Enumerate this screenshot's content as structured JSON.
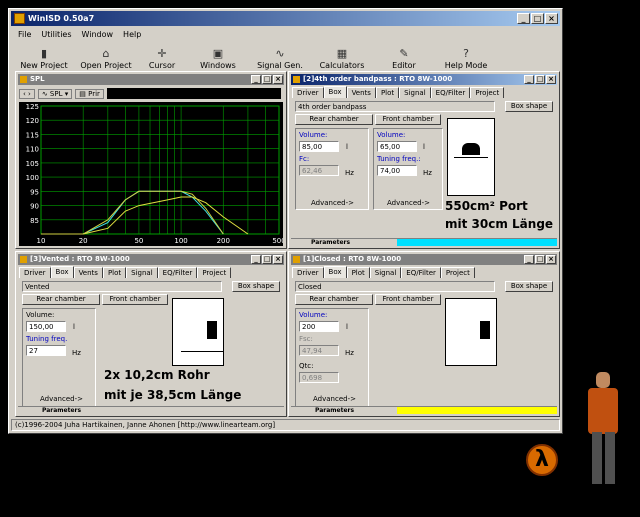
{
  "app": {
    "title": "WinISD 0.50a7",
    "menu": [
      "File",
      "Utilities",
      "Window",
      "Help"
    ],
    "toolbar": {
      "new_project": "New Project",
      "open_project": "Open Project",
      "cursor": "Cursor",
      "windows": "Windows",
      "signal_gen": "Signal Gen.",
      "calculators": "Calculators",
      "editor": "Editor",
      "help_mode": "Help Mode"
    },
    "status": "(c)1996-2004 Juha Hartikainen, Janne Ahonen [http://www.linearteam.org]"
  },
  "spl": {
    "title": "SPL",
    "mode_label": "SPL",
    "print_label": "Prir",
    "colors": {
      "series_cyan": "#40e0e0",
      "series_yellow": "#e0e040",
      "grid": "#00a000"
    }
  },
  "chart_data": {
    "type": "line",
    "title": "",
    "xlabel": "",
    "ylabel": "",
    "x_scale": "log",
    "xlim": [
      10,
      500
    ],
    "ylim": [
      80,
      125
    ],
    "x_ticks": [
      "10",
      "20",
      "50",
      "100",
      "200",
      "500"
    ],
    "y_ticks": [
      "125",
      "120",
      "115",
      "110",
      "105",
      "100",
      "95",
      "90",
      "85"
    ],
    "series": [
      {
        "color": "#40e0e0",
        "x": [
          10,
          20,
          30,
          40,
          50,
          60,
          80,
          100,
          120,
          150,
          200
        ],
        "y": [
          57,
          72,
          84,
          92,
          95,
          95,
          95,
          95,
          93,
          88,
          78
        ]
      },
      {
        "color": "#e0e040",
        "x": [
          10,
          20,
          30,
          40,
          50,
          80,
          100,
          120,
          150,
          200,
          300
        ],
        "y": [
          55,
          70,
          82,
          88,
          90,
          92,
          93,
          93,
          91,
          86,
          80
        ]
      },
      {
        "color": "#d0d040",
        "x": [
          10,
          20,
          30,
          40,
          50,
          80,
          100,
          120,
          150,
          200
        ],
        "y": [
          60,
          74,
          85,
          92,
          95,
          95,
          95,
          94,
          89,
          80
        ]
      }
    ]
  },
  "bandpass": {
    "title": "[2]4th order bandpass : RTO 8W-1000",
    "tabs": [
      "Driver",
      "Box",
      "Vents",
      "Plot",
      "Signal",
      "EQ/Filter",
      "Project"
    ],
    "box_name": "4th order bandpass",
    "box_shape": "Box shape",
    "rear_chamber": "Rear chamber",
    "front_chamber": "Front chamber",
    "rear_volume_label": "Volume:",
    "rear_volume": "85,00",
    "rear_volume_unit": "l",
    "fsc_label": "Fc:",
    "fsc_value": "62,46",
    "fsc_unit": "Hz",
    "front_volume_label": "Volume:",
    "front_volume": "65,00",
    "front_volume_unit": "l",
    "tuning_label": "Tuning freq.:",
    "tuning_value": "74,00",
    "tuning_unit": "Hz",
    "advanced": "Advanced->",
    "params": "Parameters",
    "annotation": [
      "550cm² Port",
      "mit 30cm Länge"
    ]
  },
  "vented": {
    "title": "[3]Vented : RTO 8W-1000",
    "tabs": [
      "Driver",
      "Box",
      "Vents",
      "Plot",
      "Signal",
      "EQ/Filter",
      "Project"
    ],
    "box_name": "Vented",
    "box_shape": "Box shape",
    "rear_chamber": "Rear chamber",
    "front_chamber": "Front chamber",
    "volume_label": "Volume:",
    "volume": "150,00",
    "volume_unit": "l",
    "tuning_label": "Tuning freq.",
    "tuning_value": "27",
    "tuning_unit": "Hz",
    "advanced": "Advanced->",
    "params": "Parameters",
    "annotation": [
      "2x 10,2cm Rohr",
      "mit je 38,5cm Länge"
    ]
  },
  "closed": {
    "title": "[1]Closed : RTO 8W-1000",
    "tabs": [
      "Driver",
      "Box",
      "Plot",
      "Signal",
      "EQ/Filter",
      "Project"
    ],
    "box_name": "Closed",
    "box_shape": "Box shape",
    "rear_chamber": "Rear chamber",
    "front_chamber": "Front chamber",
    "volume_label": "Volume:",
    "volume": "200",
    "volume_unit": "l",
    "fsc_label": "Fsc:",
    "fsc_value": "47,94",
    "fsc_unit": "Hz",
    "qtc_label": "Qtc:",
    "qtc_value": "0,698",
    "advanced": "Advanced->",
    "params": "Parameters"
  },
  "desktop": {
    "logo": "λ"
  }
}
